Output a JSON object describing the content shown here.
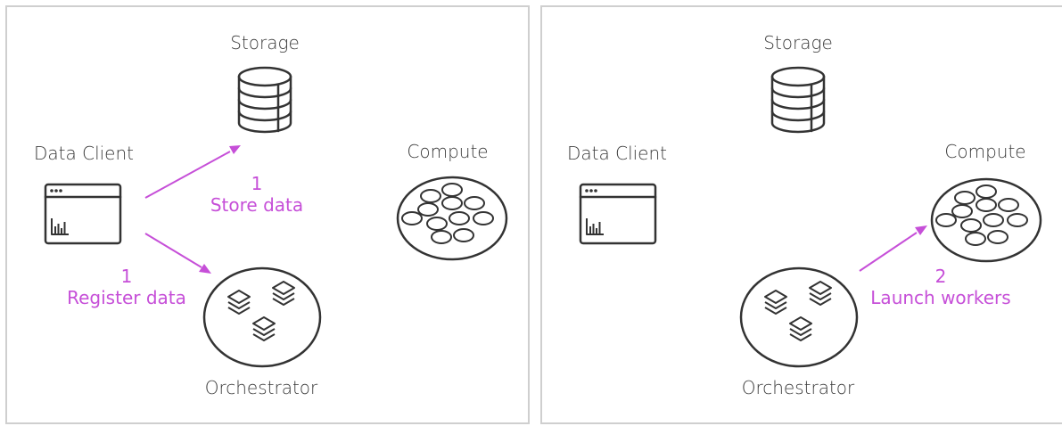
{
  "colors": {
    "accent": "#c64fd8",
    "stroke": "#333333",
    "border": "#cfcfcf"
  },
  "panels": [
    {
      "storage_label": "Storage",
      "client_label": "Data Client",
      "compute_label": "Compute",
      "orchestrator_label": "Orchestrator",
      "steps": [
        {
          "number": "1",
          "text": "Store data"
        },
        {
          "number": "1",
          "text": "Register data"
        }
      ]
    },
    {
      "storage_label": "Storage",
      "client_label": "Data Client",
      "compute_label": "Compute",
      "orchestrator_label": "Orchestrator",
      "steps": [
        {
          "number": "2",
          "text": "Launch workers"
        }
      ]
    }
  ],
  "icons": {
    "storage": "database-icon",
    "client": "browser-chart-icon",
    "compute": "compute-cluster-icon",
    "orchestrator": "orchestrator-layers-icon"
  }
}
